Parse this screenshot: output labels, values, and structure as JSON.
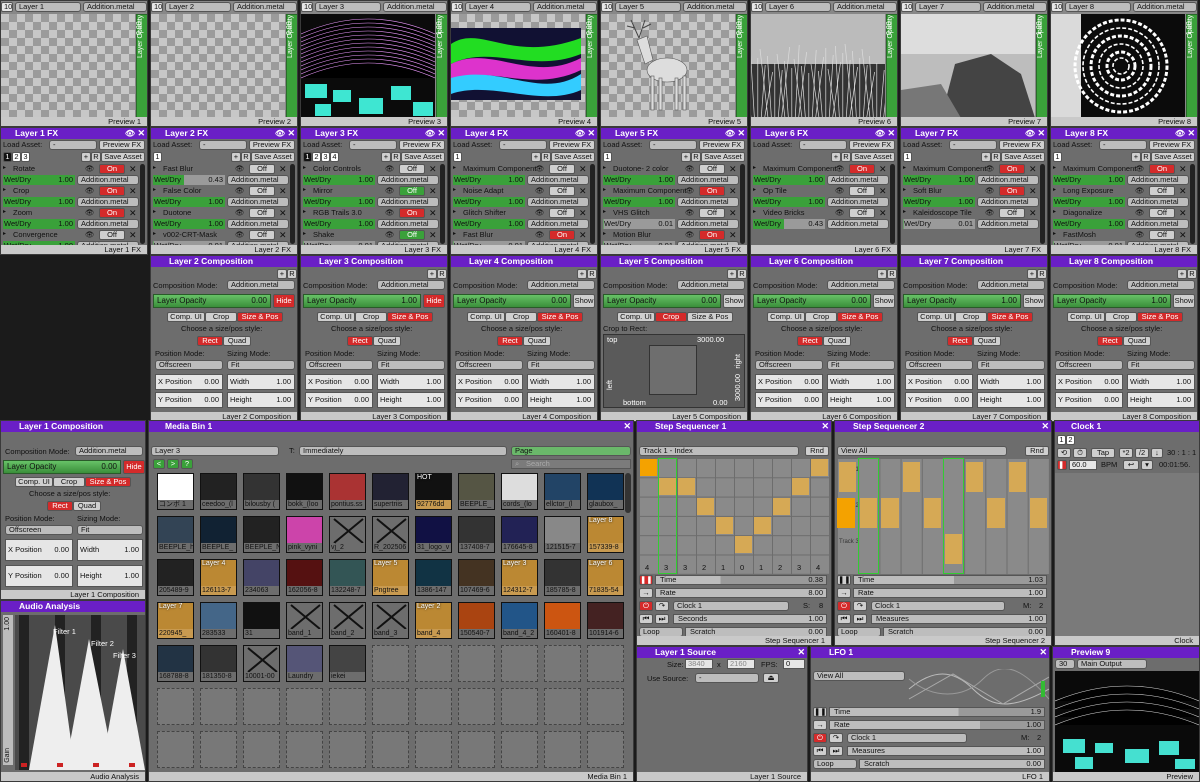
{
  "layers": [
    {
      "num": "10",
      "name": "Layer 1",
      "mode": "Addition.metal",
      "opacity": "0.00",
      "preview": "Preview 1",
      "img": "none"
    },
    {
      "num": "10",
      "name": "Layer 2",
      "mode": "Addition.metal",
      "opacity": "0.00",
      "preview": "Preview 2",
      "img": "none"
    },
    {
      "num": "10",
      "name": "Layer 3",
      "mode": "Addition.metal",
      "opacity": "1.00",
      "preview": "Preview 3",
      "img": "grid"
    },
    {
      "num": "10",
      "name": "Layer 4",
      "mode": "Addition.metal",
      "opacity": "0.00",
      "preview": "Preview 4",
      "img": "waves"
    },
    {
      "num": "10",
      "name": "Layer 5",
      "mode": "Addition.metal",
      "opacity": "0.00",
      "preview": "Preview 5",
      "img": "deer"
    },
    {
      "num": "10",
      "name": "Layer 6",
      "mode": "Addition.metal",
      "opacity": "0.00",
      "preview": "Preview 6",
      "img": "grass"
    },
    {
      "num": "10",
      "name": "Layer 7",
      "mode": "Addition.metal",
      "opacity": "1.00",
      "preview": "Preview 7",
      "img": "rock"
    },
    {
      "num": "10",
      "name": "Layer 8",
      "mode": "Addition.metal",
      "opacity": "1.00",
      "preview": "Preview 8",
      "img": "rings"
    }
  ],
  "ui": {
    "layer_opacity_label": "Layer Opacity",
    "load_asset": "Load Asset:",
    "preview_fx": "Preview FX",
    "save_asset": "Save Asset",
    "wetdry": "Wet/Dry",
    "on": "On",
    "off": "Off",
    "composition_mode": "Composition Mode:",
    "hide": "Hide",
    "show": "Show",
    "comp_ui": "Comp. UI",
    "crop": "Crop",
    "size_pos": "Size & Pos",
    "choose_style": "Choose a size/pos style:",
    "rect": "Rect",
    "quad": "Quad",
    "position_mode": "Position Mode:",
    "sizing_mode": "Sizing Mode:",
    "offscreen": "Offscreen",
    "fit": "Fit",
    "x_position": "X Position",
    "y_position": "Y Position",
    "width": "Width",
    "height": "Height",
    "crop_to_rect": "Crop to Rect:",
    "top": "top",
    "bottom": "bottom",
    "left": "left",
    "right": "right",
    "crop_val": "3000.00",
    "zero": "0.00",
    "one": "1.00",
    "dash": "-"
  },
  "fx_panels": [
    {
      "title": "Layer 1 FX",
      "foot": "Layer 1 FX",
      "tabs": [
        "1",
        "2",
        "3"
      ],
      "active_tab": 0,
      "rows": [
        {
          "name": "Rotate",
          "state": "on",
          "wet": "1.00",
          "mode": "Addition.metal"
        },
        {
          "name": "Crop",
          "state": "on",
          "wet": "1.00",
          "mode": "Addition.metal"
        },
        {
          "name": "Zoom",
          "state": "on",
          "wet": "1.00",
          "mode": "Addition.metal"
        },
        {
          "name": "Convergence",
          "state": "off",
          "wet": "1.00",
          "mode": "Addition.metal"
        },
        {
          "name": "MultiFrame 2x2",
          "state": "off",
          "wet": "0.00",
          "mode": "Addition.metal"
        },
        {
          "name": "Waveform Displace",
          "state": "off",
          "wet": "0.01",
          "mode": "Addition.metal"
        },
        {
          "name": "Chroma Zoom",
          "state": "off",
          "wet": "0.01",
          "mode": "Addition.metal"
        },
        {
          "name": "Noise Adapt",
          "state": "off",
          "wet": "0.01",
          "mode": "Addition.metal"
        },
        {
          "name": "Time Glitch RGB",
          "state": "off",
          "wet": "0.01",
          "mode": "Addition.metal"
        },
        {
          "name": "Color Invert",
          "state": "off",
          "wet": "1.00",
          "mode": "Addition.metal"
        }
      ]
    },
    {
      "title": "Layer 2 FX",
      "foot": "Layer 2 FX",
      "tabs": [
        "1"
      ],
      "active_tab": -1,
      "rows": [
        {
          "name": "Fast Blur",
          "state": "off",
          "wet": "0.43",
          "mode": "Addition.metal"
        },
        {
          "name": "False Color",
          "state": "off",
          "wet": "1.00",
          "mode": "Addition.metal"
        },
        {
          "name": "Duotone",
          "state": "off",
          "wet": "1.00",
          "mode": "Addition.metal"
        },
        {
          "name": "v002-CRT-Mask",
          "state": "off",
          "wet": "0.01",
          "mode": "Addition.metal"
        }
      ]
    },
    {
      "title": "Layer 3 FX",
      "foot": "Layer 3 FX",
      "tabs": [
        "1",
        "2",
        "3",
        "4"
      ],
      "active_tab": 0,
      "rows": [
        {
          "name": "Color Controls",
          "state": "off",
          "wet": "1.00",
          "mode": "Addition.metal"
        },
        {
          "name": "Mirror",
          "state": "off-g",
          "wet": "1.00",
          "mode": "Addition.metal"
        },
        {
          "name": "RGB Trails 3.0",
          "state": "on",
          "wet": "1.00",
          "mode": "Addition.metal"
        },
        {
          "name": "Shake",
          "state": "off-g",
          "wet": "0.01",
          "mode": "Addition.metal"
        }
      ]
    },
    {
      "title": "Layer 4 FX",
      "foot": "Layer 4 FX",
      "tabs": [
        "1"
      ],
      "active_tab": -1,
      "rows": [
        {
          "name": "Maximum Component",
          "state": "off",
          "wet": "1.00",
          "mode": "Addition.metal"
        },
        {
          "name": "Noise Adapt",
          "state": "off",
          "wet": "1.00",
          "mode": "Addition.metal"
        },
        {
          "name": "Glitch Shifter",
          "state": "off",
          "wet": "1.00",
          "mode": "Addition.metal"
        },
        {
          "name": "Fast Blur",
          "state": "on",
          "wet": "0.01",
          "mode": "Addition.metal"
        }
      ]
    },
    {
      "title": "Layer 5 FX",
      "foot": "Layer 5 FX",
      "tabs": [
        "1"
      ],
      "active_tab": -1,
      "rows": [
        {
          "name": "Duotone- 2 color",
          "state": "off",
          "wet": "1.00",
          "mode": "Addition.metal"
        },
        {
          "name": "Maximum Component",
          "state": "on",
          "wet": "1.00",
          "mode": "Addition.metal"
        },
        {
          "name": "VHS Glitch",
          "state": "off",
          "wet": "0.01",
          "mode": "Addition.metal"
        },
        {
          "name": "Motion Blur",
          "state": "on",
          "wet": "0.01",
          "mode": "Addition.metal"
        }
      ]
    },
    {
      "title": "Layer 6 FX",
      "foot": "Layer 6 FX",
      "tabs": [],
      "active_tab": -1,
      "rows": [
        {
          "name": "Maximum Component",
          "state": "on",
          "wet": "1.00",
          "mode": "Addition.metal"
        },
        {
          "name": "Op Tile",
          "state": "off",
          "wet": "1.00",
          "mode": "Addition.metal"
        },
        {
          "name": "Video Bricks",
          "state": "off",
          "wet": "0.43",
          "mode": "Addition.metal"
        }
      ]
    },
    {
      "title": "Layer 7 FX",
      "foot": "Layer 7 FX",
      "tabs": [
        "1"
      ],
      "active_tab": -1,
      "rows": [
        {
          "name": "Maximum Component",
          "state": "on",
          "wet": "1.00",
          "mode": "Addition.metal"
        },
        {
          "name": "Soft Blur",
          "state": "on",
          "wet": "1.00",
          "mode": "Addition.metal"
        },
        {
          "name": "Kaleidoscope Tile",
          "state": "off",
          "wet": "0.01",
          "mode": "Addition.metal"
        }
      ]
    },
    {
      "title": "Layer 8 FX",
      "foot": "Layer 8 FX",
      "tabs": [
        "1"
      ],
      "active_tab": -1,
      "rows": [
        {
          "name": "Maximum Component",
          "state": "on",
          "wet": "1.00",
          "mode": "Addition.metal"
        },
        {
          "name": "Long Exposure",
          "state": "off",
          "wet": "1.00",
          "mode": "Addition.metal"
        },
        {
          "name": "Diagonalize",
          "state": "off",
          "wet": "1.00",
          "mode": "Addition.metal"
        },
        {
          "name": "FastMosh",
          "state": "off",
          "wet": "0.01",
          "mode": "Addition.metal"
        }
      ]
    }
  ],
  "comps": [
    {
      "title": "Layer 2 Composition",
      "foot": "Layer 2 Composition",
      "opacity": "0.00",
      "frac": 0,
      "vis": "hide",
      "tab": "size"
    },
    {
      "title": "Layer 3 Composition",
      "foot": "Layer 3 Composition",
      "opacity": "1.00",
      "frac": 1,
      "vis": "hide",
      "tab": "size"
    },
    {
      "title": "Layer 4 Composition",
      "foot": "Layer 4 Composition",
      "opacity": "0.00",
      "frac": 0,
      "vis": "show",
      "tab": "size"
    },
    {
      "title": "Layer 5 Composition",
      "foot": "Layer 5 Composition",
      "opacity": "0.00",
      "frac": 0,
      "vis": "show",
      "tab": "crop"
    },
    {
      "title": "Layer 6 Composition",
      "foot": "Layer 6 Composition",
      "opacity": "0.00",
      "frac": 0,
      "vis": "show",
      "tab": "size"
    },
    {
      "title": "Layer 7 Composition",
      "foot": "Layer 7 Composition",
      "opacity": "1.00",
      "frac": 1,
      "vis": "show",
      "tab": "size"
    },
    {
      "title": "Layer 8 Composition",
      "foot": "Layer 8 Composition",
      "opacity": "1.00",
      "frac": 1,
      "vis": "show",
      "tab": "size"
    }
  ],
  "layer1comp": {
    "title": "Layer 1 Composition",
    "foot": "Layer 1 Composition",
    "opacity": "0.00",
    "mode": "Addition.metal"
  },
  "audio": {
    "title": "Audio Analysis",
    "foot": "Audio Analysis",
    "gain": "Gain",
    "val": "1.00",
    "filters": [
      "Filter 1",
      "Filter 2",
      "Filter 3"
    ]
  },
  "mediabin": {
    "title": "Media Bin 1",
    "foot": "Media Bin 1",
    "target": "Layer 3",
    "trigger_label": "T:",
    "trigger": "Immediately",
    "page": "Page",
    "search": "Search",
    "nav": [
      "<",
      ">",
      "?"
    ],
    "items": [
      {
        "c": "コンボ 1",
        "bg": "#fff",
        "tag": ""
      },
      {
        "c": "ceedoo_(l",
        "bg": "#222",
        "tag": ""
      },
      {
        "c": "bilousby (",
        "bg": "#333",
        "tag": ""
      },
      {
        "c": "bokk_(loo",
        "bg": "#111",
        "tag": ""
      },
      {
        "c": "pontius.ss",
        "bg": "#a33",
        "tag": ""
      },
      {
        "c": "supertriis",
        "bg": "#223",
        "tag": ""
      },
      {
        "c": "92776dd",
        "bg": "#111",
        "tag": "HOT"
      },
      {
        "c": "BEEPLE_",
        "bg": "#554",
        "tag": ""
      },
      {
        "c": "cords_(lo",
        "bg": "#ddd",
        "tag": ""
      },
      {
        "c": "ellctor_(l",
        "bg": "#246",
        "tag": ""
      },
      {
        "c": "glaubox_",
        "bg": "#135",
        "tag": ""
      },
      {
        "c": "BEEPLE_h",
        "bg": "#345",
        "tag": ""
      },
      {
        "c": "BEEPLE_",
        "bg": "#123",
        "tag": ""
      },
      {
        "c": "BEEPLE_N",
        "bg": "#222",
        "tag": ""
      },
      {
        "c": "pink_vyni",
        "bg": "#c4a",
        "tag": ""
      },
      {
        "c": "vj_2",
        "bg": "x",
        "tag": ""
      },
      {
        "c": "R_202506",
        "bg": "x",
        "tag": ""
      },
      {
        "c": "31_logo_v",
        "bg": "#114",
        "tag": ""
      },
      {
        "c": "137408-7",
        "bg": "#333",
        "tag": ""
      },
      {
        "c": "176645-8",
        "bg": "#225",
        "tag": ""
      },
      {
        "c": "121515-7",
        "bg": "#888",
        "tag": ""
      },
      {
        "c": "157339-8",
        "bg": "#b83",
        "tag": "Layer 8"
      },
      {
        "c": "205489-9",
        "bg": "#222",
        "tag": ""
      },
      {
        "c": "126113-7",
        "bg": "#b83",
        "tag": "Layer 4"
      },
      {
        "c": "234063",
        "bg": "#446",
        "tag": ""
      },
      {
        "c": "162056-8",
        "bg": "#511",
        "tag": ""
      },
      {
        "c": "132248-7",
        "bg": "#355",
        "tag": ""
      },
      {
        "c": "Pngtree",
        "bg": "#b83",
        "tag": "Layer 5"
      },
      {
        "c": "1386-147",
        "bg": "#134",
        "tag": ""
      },
      {
        "c": "107469-6",
        "bg": "#432",
        "tag": ""
      },
      {
        "c": "124312-7",
        "bg": "#b83",
        "tag": "Layer 3"
      },
      {
        "c": "185785-8",
        "bg": "#333",
        "tag": ""
      },
      {
        "c": "71835-54",
        "bg": "#b83",
        "tag": "Layer 6"
      },
      {
        "c": "220945_",
        "bg": "#b83",
        "tag": "Layer 7"
      },
      {
        "c": "283533",
        "bg": "#468",
        "tag": ""
      },
      {
        "c": "31",
        "bg": "#111",
        "tag": ""
      },
      {
        "c": "band_1",
        "bg": "x",
        "tag": ""
      },
      {
        "c": "band_2",
        "bg": "x",
        "tag": ""
      },
      {
        "c": "band_3",
        "bg": "x",
        "tag": ""
      },
      {
        "c": "band_4",
        "bg": "#b83",
        "tag": "Layer 2"
      },
      {
        "c": "150540-7",
        "bg": "#a41",
        "tag": ""
      },
      {
        "c": "band_4_2",
        "bg": "#258",
        "tag": ""
      },
      {
        "c": "160401-8",
        "bg": "#c51",
        "tag": ""
      },
      {
        "c": "101914-6",
        "bg": "#422",
        "tag": ""
      },
      {
        "c": "168788-8",
        "bg": "#234",
        "tag": ""
      },
      {
        "c": "181350-8",
        "bg": "#333",
        "tag": ""
      },
      {
        "c": "10001-00",
        "bg": "x",
        "tag": ""
      },
      {
        "c": "Laundry",
        "bg": "#557",
        "tag": ""
      },
      {
        "c": "iekei",
        "bg": "#444",
        "tag": ""
      }
    ],
    "empty_count": 51
  },
  "seq1": {
    "title": "Step Sequencer 1",
    "foot": "Step Sequencer 1",
    "track": "Track 1 - Index",
    "rnd": "Rnd",
    "labels": [
      "4",
      "3",
      "3",
      "2",
      "1",
      "0",
      "1",
      "2",
      "3",
      "4"
    ],
    "heights": [
      4,
      3,
      3,
      2,
      1,
      0,
      1,
      2,
      3,
      4
    ],
    "time": "Time",
    "time_val": "0.38",
    "rate": "Rate",
    "rate_val": "8.00",
    "clock": "Clock 1",
    "s": "S:",
    "s_val": "8",
    "seconds": "Seconds",
    "sec_val": "1.00",
    "loop": "Loop",
    "scratch": "Scratch",
    "scr_val": "0.00"
  },
  "seq2": {
    "title": "Step Sequencer 2",
    "foot": "Step Sequencer 2",
    "view": "View All",
    "rnd": "Rnd",
    "tracks": [
      "Track 1",
      "Track 2",
      "Track 3"
    ],
    "time": "Time",
    "time_val": "1.03",
    "rate": "Rate",
    "rate_val": "1.00",
    "clock": "Clock 1",
    "m": "M:",
    "m_val": "2",
    "measures": "Measures",
    "mea_val": "1.00",
    "loop": "Loop",
    "scratch": "Scratch",
    "scr_val": "0.00"
  },
  "clock": {
    "title": "Clock 1",
    "foot": "Clock",
    "tabs": [
      "1",
      "2"
    ],
    "tap": "Tap",
    "x2": "*2",
    "div2": "/2",
    "bpm_val": "60.0",
    "bpm": "BPM",
    "pos": "30 : 1 : 1",
    "time": "00:01:56."
  },
  "source": {
    "title": "Layer 1 Source",
    "foot": "Layer 1 Source",
    "size": "Size:",
    "w": "3840",
    "x": "x",
    "h": "2160",
    "fps": "FPS:",
    "fps_val": "0",
    "use": "Use Source:",
    "use_val": "-"
  },
  "lfo": {
    "title": "LFO 1",
    "foot": "LFO 1",
    "view": "View All",
    "time": "Time",
    "time_val": "1.9",
    "rate": "Rate",
    "rate_val": "1.00",
    "clock": "Clock 1",
    "m": "M:",
    "m_val": "2",
    "measures": "Measures",
    "mea_val": "1.00",
    "loop": "Loop",
    "scratch": "Scratch",
    "scr_val": "0.00"
  },
  "preview9": {
    "title": "Preview 9",
    "foot": "Preview",
    "num": "30",
    "output": "Main Output"
  }
}
